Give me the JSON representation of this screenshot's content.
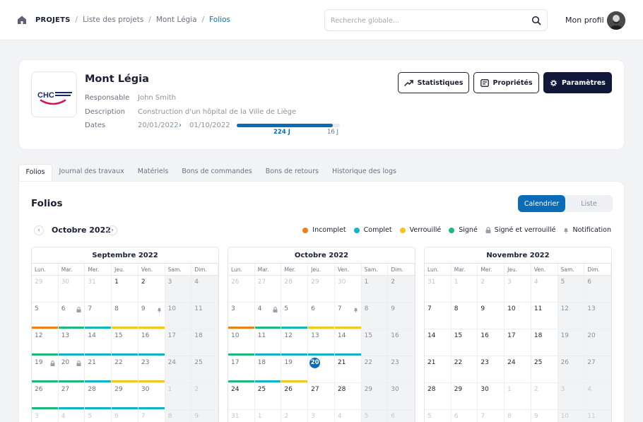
{
  "header": {
    "breadcrumb": [
      "PROJETS",
      "Liste des projets",
      "Mont Légia",
      "Folios"
    ],
    "search_placeholder": "Recherche globale...",
    "profile_label": "Mon profil"
  },
  "project": {
    "name": "Mont Légia",
    "logo_text": "CHC",
    "responsable_label": "Responsable",
    "responsable": "John Smith",
    "description_label": "Description",
    "description": "Construction d'un hôpital de la Ville de Liège",
    "dates_label": "Dates",
    "date_start": "20/01/2022",
    "date_end": "01/10/2022",
    "elapsed_label": "224 J",
    "remaining_label": "16 J",
    "progress_fraction": 0.93
  },
  "actions": {
    "stats": "Statistiques",
    "props": "Propriétés",
    "params": "Paramètres"
  },
  "tabs": [
    "Folios",
    "Journal des travaux",
    "Matériels",
    "Bons de commandes",
    "Bons de retours",
    "Historique des logs"
  ],
  "folios": {
    "title": "Folios",
    "view_calendar": "Calendrier",
    "view_list": "Liste",
    "current_month": "Octobre 2022",
    "prev_icon": "chevron-left-icon",
    "next_icon": "chevron-right-icon"
  },
  "legend": [
    {
      "label": "Incomplet",
      "color": "#e8821e",
      "kind": "dot"
    },
    {
      "label": "Complet",
      "color": "#14b3c4",
      "kind": "dot"
    },
    {
      "label": "Verrouillé",
      "color": "#f2c81e",
      "kind": "dot"
    },
    {
      "label": "Signé",
      "color": "#1fb87a",
      "kind": "dot"
    },
    {
      "label": "Signé et verrouillé",
      "color": "#9aa0ab",
      "kind": "lock"
    },
    {
      "label": "Notification",
      "color": "#9aa0ab",
      "kind": "bell"
    }
  ],
  "status_colors": {
    "incomplet": "#e8821e",
    "complet": "#14b3c4",
    "verrouille": "#f2c81e",
    "signe": "#1fb87a"
  },
  "weekdays": [
    "Lun.",
    "Mar.",
    "Mer.",
    "Jeu.",
    "Ven.",
    "Sam.",
    "Dim."
  ],
  "calendars": [
    {
      "title": "Septembre 2022",
      "weeks": [
        [
          {
            "d": "29",
            "o": 1
          },
          {
            "d": "30",
            "o": 1
          },
          {
            "d": "31",
            "o": 1
          },
          {
            "d": "1",
            "a": 1
          },
          {
            "d": "2",
            "a": 1
          },
          {
            "d": "3"
          },
          {
            "d": "4"
          }
        ],
        [
          {
            "d": "5",
            "s": "incomplet"
          },
          {
            "d": "6",
            "s": "signe",
            "i": "lock"
          },
          {
            "d": "7",
            "s": "complet"
          },
          {
            "d": "8",
            "s": "verrouille"
          },
          {
            "d": "9",
            "s": "verrouille",
            "i": "bell"
          },
          {
            "d": "10"
          },
          {
            "d": "11"
          }
        ],
        [
          {
            "d": "12",
            "s": "signe"
          },
          {
            "d": "13",
            "s": "complet"
          },
          {
            "d": "14",
            "s": "complet"
          },
          {
            "d": "15",
            "s": "complet"
          },
          {
            "d": "16",
            "s": "complet"
          },
          {
            "d": "17"
          },
          {
            "d": "18"
          }
        ],
        [
          {
            "d": "19",
            "s": "signe",
            "i": "lock"
          },
          {
            "d": "20",
            "s": "signe",
            "i": "lock"
          },
          {
            "d": "21",
            "s": "complet"
          },
          {
            "d": "22",
            "s": "verrouille"
          },
          {
            "d": "23",
            "s": "verrouille"
          },
          {
            "d": "24"
          },
          {
            "d": "25"
          }
        ],
        [
          {
            "d": "26",
            "s": "signe"
          },
          {
            "d": "27",
            "s": "complet"
          },
          {
            "d": "28",
            "s": "complet"
          },
          {
            "d": "29",
            "s": "complet"
          },
          {
            "d": "30",
            "s": "complet"
          },
          {
            "d": "1",
            "o": 1
          },
          {
            "d": "2",
            "o": 1
          }
        ],
        [
          {
            "d": "3",
            "o": 1
          },
          {
            "d": "4",
            "o": 1
          },
          {
            "d": "5",
            "o": 1
          },
          {
            "d": "6",
            "o": 1
          },
          {
            "d": "7",
            "o": 1
          },
          {
            "d": "8",
            "o": 1
          },
          {
            "d": "9",
            "o": 1
          }
        ]
      ]
    },
    {
      "title": "Octobre 2022",
      "weeks": [
        [
          {
            "d": "26",
            "o": 1
          },
          {
            "d": "27",
            "o": 1
          },
          {
            "d": "28",
            "o": 1
          },
          {
            "d": "29",
            "o": 1
          },
          {
            "d": "30",
            "o": 1
          },
          {
            "d": "1"
          },
          {
            "d": "2"
          }
        ],
        [
          {
            "d": "3",
            "s": "incomplet"
          },
          {
            "d": "4",
            "s": "signe",
            "i": "lock"
          },
          {
            "d": "5",
            "s": "complet"
          },
          {
            "d": "6",
            "s": "verrouille"
          },
          {
            "d": "7",
            "s": "verrouille",
            "i": "bell"
          },
          {
            "d": "8"
          },
          {
            "d": "9"
          }
        ],
        [
          {
            "d": "10",
            "s": "signe"
          },
          {
            "d": "11",
            "s": "complet"
          },
          {
            "d": "12",
            "s": "complet"
          },
          {
            "d": "13",
            "s": "complet"
          },
          {
            "d": "14",
            "s": "complet"
          },
          {
            "d": "15"
          },
          {
            "d": "16"
          }
        ],
        [
          {
            "d": "17",
            "s": "signe"
          },
          {
            "d": "18",
            "s": "complet"
          },
          {
            "d": "19",
            "s": "verrouille"
          },
          {
            "d": "20",
            "t": 1,
            "a": 1
          },
          {
            "d": "21",
            "a": 1
          },
          {
            "d": "22"
          },
          {
            "d": "23"
          }
        ],
        [
          {
            "d": "24",
            "a": 1
          },
          {
            "d": "25",
            "a": 1
          },
          {
            "d": "26",
            "a": 1
          },
          {
            "d": "27",
            "a": 1
          },
          {
            "d": "28",
            "a": 1
          },
          {
            "d": "29"
          },
          {
            "d": "30"
          }
        ],
        [
          {
            "d": "31",
            "o": 1
          },
          {
            "d": "1",
            "o": 1
          },
          {
            "d": "2",
            "o": 1
          },
          {
            "d": "3",
            "o": 1
          },
          {
            "d": "4",
            "o": 1
          },
          {
            "d": "5",
            "o": 1
          },
          {
            "d": "6",
            "o": 1
          }
        ]
      ]
    },
    {
      "title": "Novembre 2022",
      "weeks": [
        [
          {
            "d": "31",
            "o": 1
          },
          {
            "d": "1",
            "o": 1
          },
          {
            "d": "2",
            "o": 1
          },
          {
            "d": "3",
            "o": 1
          },
          {
            "d": "4",
            "o": 1
          },
          {
            "d": "5"
          },
          {
            "d": "6"
          }
        ],
        [
          {
            "d": "7",
            "a": 1
          },
          {
            "d": "8",
            "a": 1
          },
          {
            "d": "9",
            "a": 1
          },
          {
            "d": "10",
            "a": 1
          },
          {
            "d": "11",
            "a": 1
          },
          {
            "d": "12"
          },
          {
            "d": "13"
          }
        ],
        [
          {
            "d": "14",
            "a": 1
          },
          {
            "d": "15",
            "a": 1
          },
          {
            "d": "16",
            "a": 1
          },
          {
            "d": "17",
            "a": 1
          },
          {
            "d": "18",
            "a": 1
          },
          {
            "d": "19"
          },
          {
            "d": "20"
          }
        ],
        [
          {
            "d": "21",
            "a": 1
          },
          {
            "d": "22",
            "a": 1
          },
          {
            "d": "23",
            "a": 1
          },
          {
            "d": "24",
            "a": 1
          },
          {
            "d": "25",
            "a": 1
          },
          {
            "d": "26"
          },
          {
            "d": "27"
          }
        ],
        [
          {
            "d": "28",
            "a": 1
          },
          {
            "d": "29",
            "a": 1
          },
          {
            "d": "30",
            "a": 1
          },
          {
            "d": "1",
            "o": 1
          },
          {
            "d": "2",
            "o": 1
          },
          {
            "d": "3",
            "o": 1
          },
          {
            "d": "4",
            "o": 1
          }
        ],
        [
          {
            "d": "5",
            "o": 1
          },
          {
            "d": "6",
            "o": 1
          },
          {
            "d": "7",
            "o": 1
          },
          {
            "d": "8",
            "o": 1
          },
          {
            "d": "9",
            "o": 1
          },
          {
            "d": "10",
            "o": 1
          },
          {
            "d": "11",
            "o": 1
          }
        ]
      ]
    }
  ]
}
